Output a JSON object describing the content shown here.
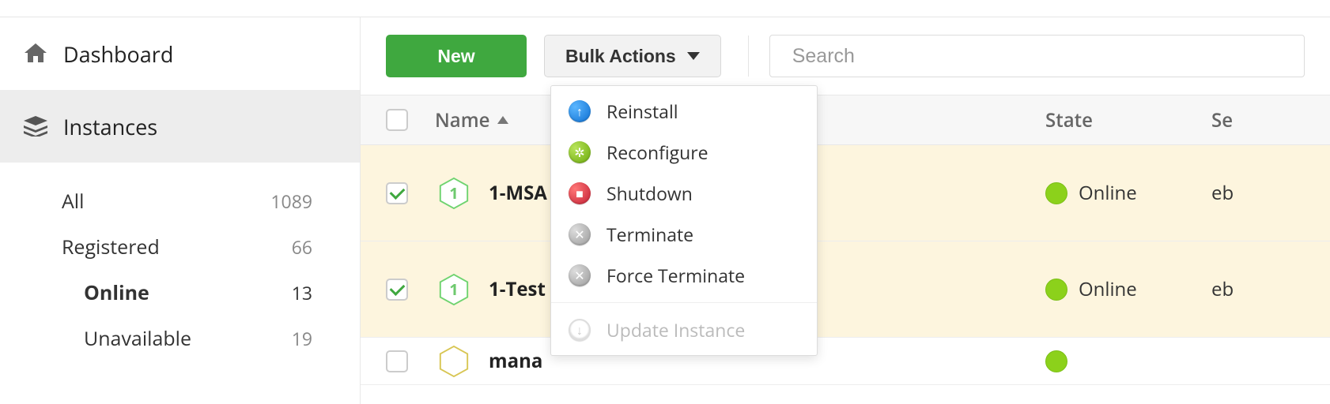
{
  "sidebar": {
    "items": [
      {
        "label": "Dashboard"
      },
      {
        "label": "Instances"
      }
    ],
    "sub": [
      {
        "label": "All",
        "count": "1089"
      },
      {
        "label": "Registered",
        "count": "66"
      },
      {
        "label": "Online",
        "count": "13"
      },
      {
        "label": "Unavailable",
        "count": "19"
      }
    ]
  },
  "toolbar": {
    "new_label": "New",
    "bulk_label": "Bulk Actions",
    "search_placeholder": "Search"
  },
  "columns": {
    "name": "Name",
    "state": "State",
    "server": "Se"
  },
  "rows": [
    {
      "badge": "1",
      "name": "1-MSA",
      "state": "Online",
      "server": "eb"
    },
    {
      "badge": "1",
      "name": "1-Test",
      "state": "Online",
      "server": "eb"
    },
    {
      "badge": "",
      "name": "mana",
      "state": "",
      "server": ""
    }
  ],
  "dropdown": {
    "items": [
      {
        "label": "Reinstall"
      },
      {
        "label": "Reconfigure"
      },
      {
        "label": "Shutdown"
      },
      {
        "label": "Terminate"
      },
      {
        "label": "Force Terminate"
      }
    ],
    "disabled": [
      {
        "label": "Update Instance"
      }
    ]
  },
  "colors": {
    "primary_green": "#3fa83f",
    "online_dot": "#8cd11b",
    "selected_row": "#fdf5de"
  }
}
